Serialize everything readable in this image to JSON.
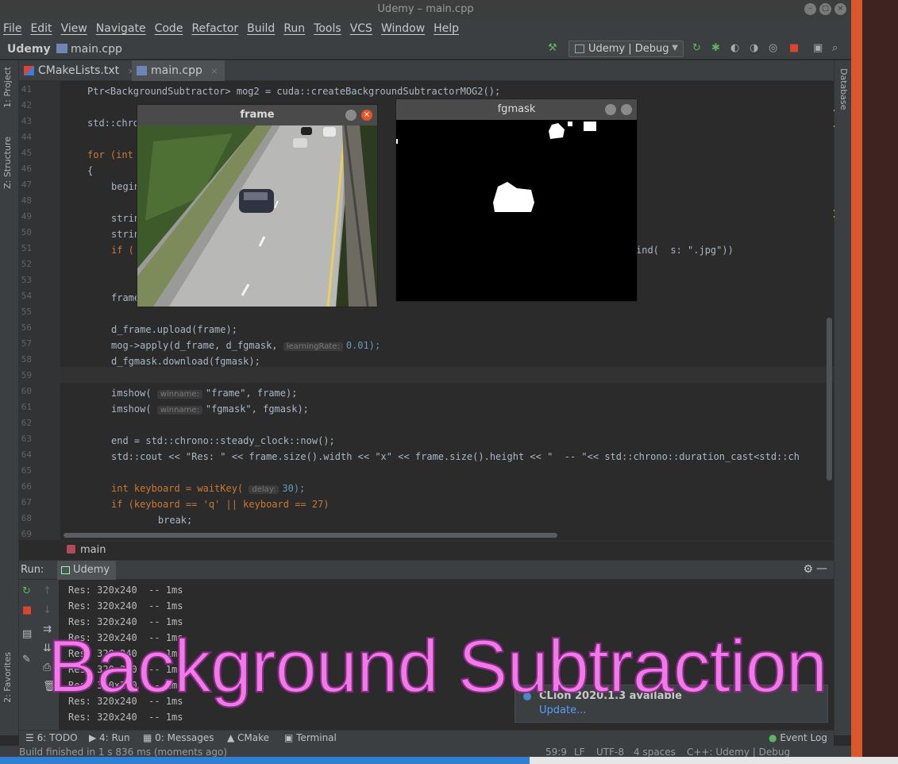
{
  "window": {
    "title": "Udemy – main.cpp"
  },
  "menu": [
    "File",
    "Edit",
    "View",
    "Navigate",
    "Code",
    "Refactor",
    "Build",
    "Run",
    "Tools",
    "VCS",
    "Window",
    "Help"
  ],
  "navbar": {
    "project": "Udemy",
    "file": "main.cpp",
    "run_config": "Udemy | Debug"
  },
  "tabs": [
    {
      "label": "CMakeLists.txt"
    },
    {
      "label": "main.cpp"
    }
  ],
  "side_tools": {
    "project": "1: Project",
    "structure": "Z: Structure",
    "favorites": "2: Favorites",
    "database": "Database"
  },
  "code": {
    "lines": [
      {
        "n": "41",
        "code": "Ptr<BackgroundSubtractor> mog2 = cuda::createBackgroundSubtractorMOG2();"
      },
      {
        "n": "42",
        "code": ""
      },
      {
        "n": "43",
        "code": "std::chrono"
      },
      {
        "n": "44",
        "code": ""
      },
      {
        "n": "45",
        "code": "for (int"
      },
      {
        "n": "46",
        "code": "{"
      },
      {
        "n": "47",
        "code": "begin"
      },
      {
        "n": "48",
        "code": ""
      },
      {
        "n": "49",
        "code": "string"
      },
      {
        "n": "50",
        "code": "string"
      },
      {
        "n": "51",
        "code": "if (",
        "tail": "ind(  s: \".jpg\"))"
      },
      {
        "n": "52",
        "code": ""
      },
      {
        "n": "53",
        "code": ""
      },
      {
        "n": "54",
        "code": "frame"
      },
      {
        "n": "55",
        "code": ""
      },
      {
        "n": "56",
        "code": "d_frame.upload(frame);"
      },
      {
        "n": "57",
        "code": "mog->apply(d_frame, d_fgmask,",
        "hint": "learningRate:",
        "rest": "0.01);"
      },
      {
        "n": "58",
        "code": "d_fgmask.download(fgmask);"
      },
      {
        "n": "59",
        "code": ""
      },
      {
        "n": "60",
        "code": "imshow(",
        "hint": "winname:",
        "rest": "\"frame\", frame);"
      },
      {
        "n": "61",
        "code": "imshow(",
        "hint": "winname:",
        "rest": "\"fgmask\", fgmask);"
      },
      {
        "n": "62",
        "code": ""
      },
      {
        "n": "63",
        "code": "end = std::chrono::steady_clock::now();"
      },
      {
        "n": "64",
        "code": "std::cout << \"Res: \" << frame.size().width << \"x\" << frame.size().height << \"  -- \"<< std::chrono::duration_cast<std::ch"
      },
      {
        "n": "65",
        "code": ""
      },
      {
        "n": "66",
        "code": "int keyboard = waitKey(",
        "hint": "delay:",
        "rest": "30);"
      },
      {
        "n": "67",
        "code": "if (keyboard == 'q' || keyboard == 27)"
      },
      {
        "n": "68",
        "code": "    break;"
      },
      {
        "n": "69",
        "code": ""
      }
    ]
  },
  "breadcrumb": "main",
  "windows": {
    "frame": {
      "title": "frame"
    },
    "fgmask": {
      "title": "fgmask"
    }
  },
  "run_panel": {
    "label": "Run:",
    "tab": "Udemy",
    "output": [
      "Res: 320x240  -- 1ms",
      "Res: 320x240  -- 1ms",
      "Res: 320x240  -- 1ms",
      "Res: 320x240  -- 1ms",
      "Res: 320x240  -- 1ms",
      "Res: 320x240  -- 1ms",
      "Res: 320x240  -- 1ms",
      "Res: 320x240  -- 1ms",
      "Res: 320x240  -- 1ms"
    ]
  },
  "notification": {
    "title": "CLion 2020.1.3 available",
    "link": "Update..."
  },
  "overlay_caption": "Background Subtraction",
  "bottom_tabs": [
    "6: TODO",
    "4: Run",
    "0: Messages",
    "CMake",
    "Terminal"
  ],
  "event_log": "Event Log",
  "status": {
    "message": "Build finished in 1 s 836 ms (moments ago)",
    "position": "59:9",
    "line_sep": "LF",
    "encoding": "UTF-8",
    "indent": "4 spaces",
    "context": "C++: Udemy | Debug"
  },
  "progress": {
    "fraction": 0.59
  },
  "colors": {
    "accent_orange": "#d9572a",
    "overlay_pink": "#f07ae8",
    "link_blue": "#589df6"
  }
}
